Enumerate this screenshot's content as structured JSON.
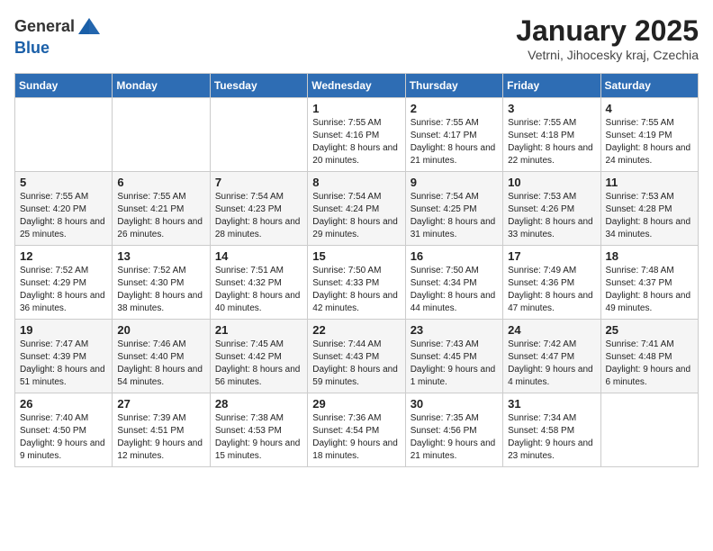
{
  "header": {
    "logo_general": "General",
    "logo_blue": "Blue",
    "month": "January 2025",
    "location": "Vetrni, Jihocesky kraj, Czechia"
  },
  "weekdays": [
    "Sunday",
    "Monday",
    "Tuesday",
    "Wednesday",
    "Thursday",
    "Friday",
    "Saturday"
  ],
  "weeks": [
    [
      {
        "day": "",
        "sunrise": "",
        "sunset": "",
        "daylight": ""
      },
      {
        "day": "",
        "sunrise": "",
        "sunset": "",
        "daylight": ""
      },
      {
        "day": "",
        "sunrise": "",
        "sunset": "",
        "daylight": ""
      },
      {
        "day": "1",
        "sunrise": "Sunrise: 7:55 AM",
        "sunset": "Sunset: 4:16 PM",
        "daylight": "Daylight: 8 hours and 20 minutes."
      },
      {
        "day": "2",
        "sunrise": "Sunrise: 7:55 AM",
        "sunset": "Sunset: 4:17 PM",
        "daylight": "Daylight: 8 hours and 21 minutes."
      },
      {
        "day": "3",
        "sunrise": "Sunrise: 7:55 AM",
        "sunset": "Sunset: 4:18 PM",
        "daylight": "Daylight: 8 hours and 22 minutes."
      },
      {
        "day": "4",
        "sunrise": "Sunrise: 7:55 AM",
        "sunset": "Sunset: 4:19 PM",
        "daylight": "Daylight: 8 hours and 24 minutes."
      }
    ],
    [
      {
        "day": "5",
        "sunrise": "Sunrise: 7:55 AM",
        "sunset": "Sunset: 4:20 PM",
        "daylight": "Daylight: 8 hours and 25 minutes."
      },
      {
        "day": "6",
        "sunrise": "Sunrise: 7:55 AM",
        "sunset": "Sunset: 4:21 PM",
        "daylight": "Daylight: 8 hours and 26 minutes."
      },
      {
        "day": "7",
        "sunrise": "Sunrise: 7:54 AM",
        "sunset": "Sunset: 4:23 PM",
        "daylight": "Daylight: 8 hours and 28 minutes."
      },
      {
        "day": "8",
        "sunrise": "Sunrise: 7:54 AM",
        "sunset": "Sunset: 4:24 PM",
        "daylight": "Daylight: 8 hours and 29 minutes."
      },
      {
        "day": "9",
        "sunrise": "Sunrise: 7:54 AM",
        "sunset": "Sunset: 4:25 PM",
        "daylight": "Daylight: 8 hours and 31 minutes."
      },
      {
        "day": "10",
        "sunrise": "Sunrise: 7:53 AM",
        "sunset": "Sunset: 4:26 PM",
        "daylight": "Daylight: 8 hours and 33 minutes."
      },
      {
        "day": "11",
        "sunrise": "Sunrise: 7:53 AM",
        "sunset": "Sunset: 4:28 PM",
        "daylight": "Daylight: 8 hours and 34 minutes."
      }
    ],
    [
      {
        "day": "12",
        "sunrise": "Sunrise: 7:52 AM",
        "sunset": "Sunset: 4:29 PM",
        "daylight": "Daylight: 8 hours and 36 minutes."
      },
      {
        "day": "13",
        "sunrise": "Sunrise: 7:52 AM",
        "sunset": "Sunset: 4:30 PM",
        "daylight": "Daylight: 8 hours and 38 minutes."
      },
      {
        "day": "14",
        "sunrise": "Sunrise: 7:51 AM",
        "sunset": "Sunset: 4:32 PM",
        "daylight": "Daylight: 8 hours and 40 minutes."
      },
      {
        "day": "15",
        "sunrise": "Sunrise: 7:50 AM",
        "sunset": "Sunset: 4:33 PM",
        "daylight": "Daylight: 8 hours and 42 minutes."
      },
      {
        "day": "16",
        "sunrise": "Sunrise: 7:50 AM",
        "sunset": "Sunset: 4:34 PM",
        "daylight": "Daylight: 8 hours and 44 minutes."
      },
      {
        "day": "17",
        "sunrise": "Sunrise: 7:49 AM",
        "sunset": "Sunset: 4:36 PM",
        "daylight": "Daylight: 8 hours and 47 minutes."
      },
      {
        "day": "18",
        "sunrise": "Sunrise: 7:48 AM",
        "sunset": "Sunset: 4:37 PM",
        "daylight": "Daylight: 8 hours and 49 minutes."
      }
    ],
    [
      {
        "day": "19",
        "sunrise": "Sunrise: 7:47 AM",
        "sunset": "Sunset: 4:39 PM",
        "daylight": "Daylight: 8 hours and 51 minutes."
      },
      {
        "day": "20",
        "sunrise": "Sunrise: 7:46 AM",
        "sunset": "Sunset: 4:40 PM",
        "daylight": "Daylight: 8 hours and 54 minutes."
      },
      {
        "day": "21",
        "sunrise": "Sunrise: 7:45 AM",
        "sunset": "Sunset: 4:42 PM",
        "daylight": "Daylight: 8 hours and 56 minutes."
      },
      {
        "day": "22",
        "sunrise": "Sunrise: 7:44 AM",
        "sunset": "Sunset: 4:43 PM",
        "daylight": "Daylight: 8 hours and 59 minutes."
      },
      {
        "day": "23",
        "sunrise": "Sunrise: 7:43 AM",
        "sunset": "Sunset: 4:45 PM",
        "daylight": "Daylight: 9 hours and 1 minute."
      },
      {
        "day": "24",
        "sunrise": "Sunrise: 7:42 AM",
        "sunset": "Sunset: 4:47 PM",
        "daylight": "Daylight: 9 hours and 4 minutes."
      },
      {
        "day": "25",
        "sunrise": "Sunrise: 7:41 AM",
        "sunset": "Sunset: 4:48 PM",
        "daylight": "Daylight: 9 hours and 6 minutes."
      }
    ],
    [
      {
        "day": "26",
        "sunrise": "Sunrise: 7:40 AM",
        "sunset": "Sunset: 4:50 PM",
        "daylight": "Daylight: 9 hours and 9 minutes."
      },
      {
        "day": "27",
        "sunrise": "Sunrise: 7:39 AM",
        "sunset": "Sunset: 4:51 PM",
        "daylight": "Daylight: 9 hours and 12 minutes."
      },
      {
        "day": "28",
        "sunrise": "Sunrise: 7:38 AM",
        "sunset": "Sunset: 4:53 PM",
        "daylight": "Daylight: 9 hours and 15 minutes."
      },
      {
        "day": "29",
        "sunrise": "Sunrise: 7:36 AM",
        "sunset": "Sunset: 4:54 PM",
        "daylight": "Daylight: 9 hours and 18 minutes."
      },
      {
        "day": "30",
        "sunrise": "Sunrise: 7:35 AM",
        "sunset": "Sunset: 4:56 PM",
        "daylight": "Daylight: 9 hours and 21 minutes."
      },
      {
        "day": "31",
        "sunrise": "Sunrise: 7:34 AM",
        "sunset": "Sunset: 4:58 PM",
        "daylight": "Daylight: 9 hours and 23 minutes."
      },
      {
        "day": "",
        "sunrise": "",
        "sunset": "",
        "daylight": ""
      }
    ]
  ]
}
